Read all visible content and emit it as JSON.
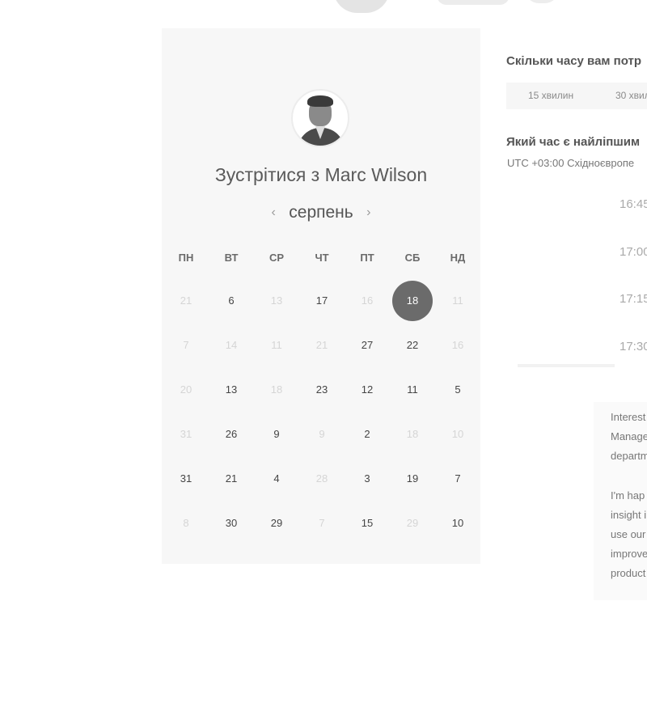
{
  "meeting": {
    "title_prefix": "Зустрітися з",
    "host_name": "Marc Wilson"
  },
  "calendar": {
    "month": "серпень",
    "prev_icon": "chevron-left-icon",
    "next_icon": "chevron-right-icon",
    "weekdays": [
      "ПН",
      "ВТ",
      "СР",
      "ЧТ",
      "ПТ",
      "СБ",
      "НД"
    ],
    "selected_color": "#6b6b6b",
    "rows": [
      [
        {
          "d": "21",
          "a": false
        },
        {
          "d": "6",
          "a": true
        },
        {
          "d": "13",
          "a": false
        },
        {
          "d": "17",
          "a": true
        },
        {
          "d": "16",
          "a": false
        },
        {
          "d": "18",
          "a": true,
          "sel": true
        },
        {
          "d": "11",
          "a": false
        }
      ],
      [
        {
          "d": "7",
          "a": false
        },
        {
          "d": "14",
          "a": false
        },
        {
          "d": "11",
          "a": false
        },
        {
          "d": "21",
          "a": false
        },
        {
          "d": "27",
          "a": true
        },
        {
          "d": "22",
          "a": true
        },
        {
          "d": "16",
          "a": false
        }
      ],
      [
        {
          "d": "20",
          "a": false
        },
        {
          "d": "13",
          "a": true
        },
        {
          "d": "18",
          "a": false
        },
        {
          "d": "23",
          "a": true
        },
        {
          "d": "12",
          "a": true
        },
        {
          "d": "11",
          "a": true
        },
        {
          "d": "5",
          "a": true
        }
      ],
      [
        {
          "d": "31",
          "a": false
        },
        {
          "d": "26",
          "a": true
        },
        {
          "d": "9",
          "a": true
        },
        {
          "d": "9",
          "a": false
        },
        {
          "d": "2",
          "a": true
        },
        {
          "d": "18",
          "a": false
        },
        {
          "d": "10",
          "a": false
        }
      ],
      [
        {
          "d": "31",
          "a": true
        },
        {
          "d": "21",
          "a": true
        },
        {
          "d": "4",
          "a": true
        },
        {
          "d": "28",
          "a": false
        },
        {
          "d": "3",
          "a": true
        },
        {
          "d": "19",
          "a": true
        },
        {
          "d": "7",
          "a": true
        }
      ],
      [
        {
          "d": "8",
          "a": false
        },
        {
          "d": "30",
          "a": true
        },
        {
          "d": "29",
          "a": true
        },
        {
          "d": "7",
          "a": false
        },
        {
          "d": "15",
          "a": true
        },
        {
          "d": "29",
          "a": false
        },
        {
          "d": "10",
          "a": true
        }
      ]
    ]
  },
  "scheduler": {
    "duration_question": "Скільки часу вам потр",
    "durations": [
      "15 хвилин",
      "30 хвил"
    ],
    "time_question": "Який час є найліпшим",
    "timezone": "UTC +03:00 Східноєвропе",
    "slots": [
      "16:45",
      "17:00",
      "17:15",
      "17:30"
    ]
  },
  "bio": {
    "paragraph1": [
      "Interest",
      "Manage",
      "departm"
    ],
    "paragraph2": [
      "I'm hap",
      "insight i",
      "use our",
      "improve",
      "product"
    ]
  }
}
